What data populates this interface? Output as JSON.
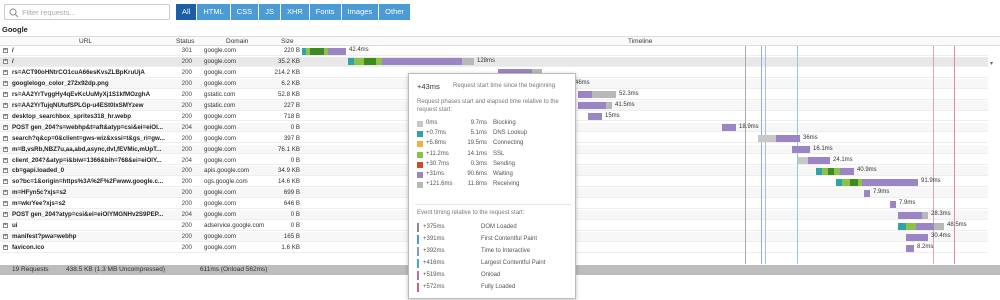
{
  "search": {
    "placeholder": "Filter requests..."
  },
  "filters": [
    "All",
    "HTML",
    "CSS",
    "JS",
    "XHR",
    "Fonts",
    "Images",
    "Other"
  ],
  "page_title": "Google",
  "columns": {
    "url": "URL",
    "status": "Status",
    "domain": "Domain",
    "size": "Size",
    "timeline": "Timeline"
  },
  "rows": [
    {
      "url": "/",
      "status": "301",
      "domain": "google.com",
      "size": "220 B",
      "time": "42.4ms"
    },
    {
      "url": "/",
      "status": "200",
      "domain": "google.com",
      "size": "35.2 KB",
      "time": "128ms"
    },
    {
      "url": "rs=ACT90oHNtrCO1cuA66esKvsZLBpKruUjA",
      "status": "200",
      "domain": "google.com",
      "size": "214.2 KB",
      "time": ""
    },
    {
      "url": "googlelogo_color_272x92dp.png",
      "status": "200",
      "domain": "google.com",
      "size": "6.2 KB",
      "time": "46ms"
    },
    {
      "url": "rs=AA2YrTvggHy4qEvKcUuMyXj1S1kfMOzghA",
      "status": "200",
      "domain": "gstatic.com",
      "size": "52.8 KB",
      "time": "52.3ms"
    },
    {
      "url": "rs=AA2YrTujqNUtufSPLGp-u4ESt0IxSMYzew",
      "status": "200",
      "domain": "gstatic.com",
      "size": "227 B",
      "time": "41.5ms"
    },
    {
      "url": "desktop_searchbox_sprites318_hr.webp",
      "status": "200",
      "domain": "google.com",
      "size": "718 B",
      "time": "15ms"
    },
    {
      "url": "POST gen_204?s=webhp&t=aft&atyp=csi&ei=eiOl...",
      "status": "204",
      "domain": "google.com",
      "size": "0 B",
      "time": "18.9ms"
    },
    {
      "url": "search?q&cp=0&client=gws-wiz&xssi=t&gs_ri=gw...",
      "status": "200",
      "domain": "google.com",
      "size": "397 B",
      "time": "36ms"
    },
    {
      "url": "m=B,vsRb,NBZ7u,aa,abd,async,dvl,fEVMic,mUpT...",
      "status": "200",
      "domain": "google.com",
      "size": "76.1 KB",
      "time": "16.1ms"
    },
    {
      "url": "client_204?&atyp=i&biw=1366&bih=768&ei=eiOlY...",
      "status": "204",
      "domain": "google.com",
      "size": "0 B",
      "time": "24.1ms"
    },
    {
      "url": "cb=gapi.loaded_0",
      "status": "200",
      "domain": "apis.google.com",
      "size": "34.9 KB",
      "time": "40.9ms"
    },
    {
      "url": "so?bc=1&origin=https%3A%2F%2Fwww.google.c...",
      "status": "200",
      "domain": "ogs.google.com",
      "size": "14.6 KB",
      "time": "91.9ms"
    },
    {
      "url": "m=HFyn5c?xjs=s2",
      "status": "200",
      "domain": "google.com",
      "size": "699 B",
      "time": "7.9ms"
    },
    {
      "url": "m=wkrYee?xjs=s2",
      "status": "200",
      "domain": "google.com",
      "size": "646 B",
      "time": "7.9ms"
    },
    {
      "url": "POST gen_204?atyp=csi&ei=eiOlYMGNHv2S9PEP...",
      "status": "204",
      "domain": "google.com",
      "size": "0 B",
      "time": "28.3ms"
    },
    {
      "url": "ui",
      "status": "200",
      "domain": "adservice.google.com",
      "size": "0 B",
      "time": "48.5ms"
    },
    {
      "url": "manifest?pwa=webhp",
      "status": "200",
      "domain": "google.com",
      "size": "165 B",
      "time": "30.4ms"
    },
    {
      "url": "favicon.ico",
      "status": "200",
      "domain": "google.com",
      "size": "1.6 KB",
      "time": "8.2ms"
    }
  ],
  "footer": {
    "requests": "19 Requests",
    "size": "438.5 KB (1.3 MB Uncompressed)",
    "time": "611ms (Onload 562ms)"
  },
  "popup": {
    "start": "+43ms",
    "start_desc": "Request start time since the beginning",
    "phases_desc": "Request phases start and elapsed time relative to the request start:",
    "phases": [
      {
        "start": "0ms",
        "dur": "9.7ms",
        "name": "Blocking",
        "color": "#c8c8c8"
      },
      {
        "start": "+0.7ms",
        "dur": "5.1ms",
        "name": "DNS Lookup",
        "color": "#2fa4a8"
      },
      {
        "start": "+5.8ms",
        "dur": "19.5ms",
        "name": "Connecting",
        "color": "#f0b040"
      },
      {
        "start": "+11.2ms",
        "dur": "14.1ms",
        "name": "SSL",
        "color": "#8bc34a"
      },
      {
        "start": "+30.7ms",
        "dur": "0.3ms",
        "name": "Sending",
        "color": "#d04a2a"
      },
      {
        "start": "+31ms",
        "dur": "90.6ms",
        "name": "Waiting",
        "color": "#9b85c4"
      },
      {
        "start": "+121.6ms",
        "dur": "11.8ms",
        "name": "Receiving",
        "color": "#b8b8b8"
      }
    ],
    "events_desc": "Event timing relative to the request start:",
    "events": [
      {
        "t": "+375ms",
        "name": "DOM Loaded",
        "color": "#888"
      },
      {
        "t": "+391ms",
        "name": "First Contentful Paint",
        "color": "#4a9bd6"
      },
      {
        "t": "+392ms",
        "name": "Time to Interactive",
        "color": "#7a9ad0"
      },
      {
        "t": "+416ms",
        "name": "Largest Contentful Paint",
        "color": "#3bb0c8"
      },
      {
        "t": "+519ms",
        "name": "Onload",
        "color": "#c070a0"
      },
      {
        "t": "+572ms",
        "name": "Fully Loaded",
        "color": "#d06080"
      }
    ]
  }
}
